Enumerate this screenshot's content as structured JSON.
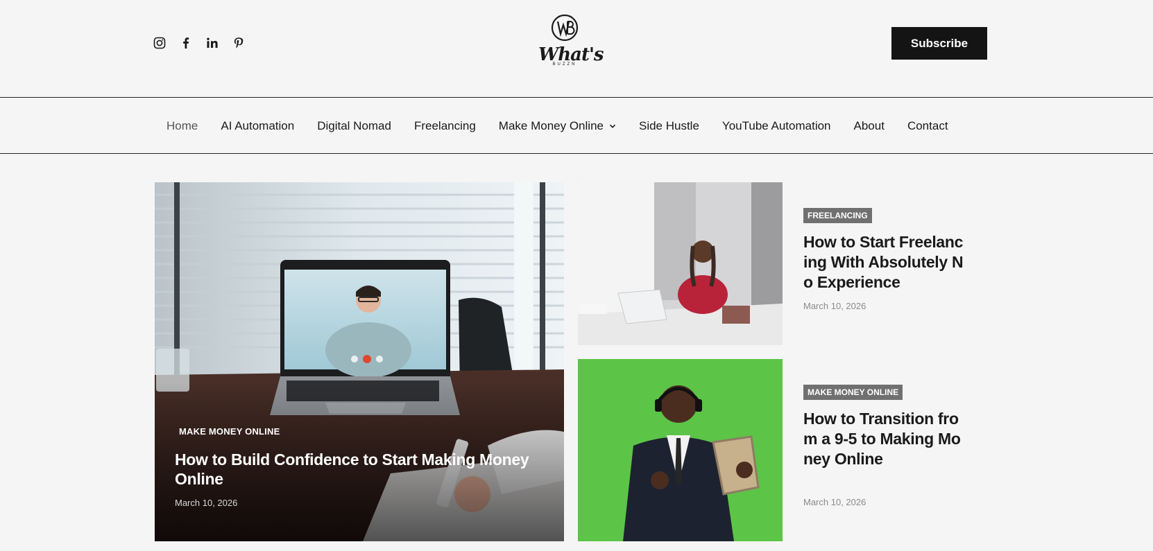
{
  "header": {
    "social_icons": [
      "instagram-icon",
      "facebook-icon",
      "linkedin-icon",
      "pinterest-icon"
    ],
    "logo": {
      "monogram": "WB",
      "wordmark": "What's",
      "tagline": "BUZZN"
    },
    "subscribe_label": "Subscribe"
  },
  "nav": {
    "items": [
      {
        "label": "Home",
        "active": true
      },
      {
        "label": "AI Automation"
      },
      {
        "label": "Digital Nomad"
      },
      {
        "label": "Freelancing"
      },
      {
        "label": "Make Money Online",
        "has_dropdown": true
      },
      {
        "label": "Side Hustle"
      },
      {
        "label": "YouTube Automation"
      },
      {
        "label": "About"
      },
      {
        "label": "Contact"
      }
    ]
  },
  "featured": {
    "category": "MAKE MONEY ONLINE",
    "title": "How to Build Confidence to Start Making Money Online",
    "date": "March 10, 2026"
  },
  "posts": [
    {
      "category": "FREELANCING",
      "title": "How to Start Freelancing With Absolutely No Experience",
      "date": "March 10, 2026"
    },
    {
      "category": "MAKE MONEY ONLINE",
      "title": "How to Transition from a 9-5 to Making Money Online",
      "date": "March 10, 2026"
    }
  ],
  "colors": {
    "page_bg": "#f5f5f5",
    "subscribe_bg": "#141414",
    "badge_bg": "#707070",
    "green_screen": "#5cc447"
  }
}
